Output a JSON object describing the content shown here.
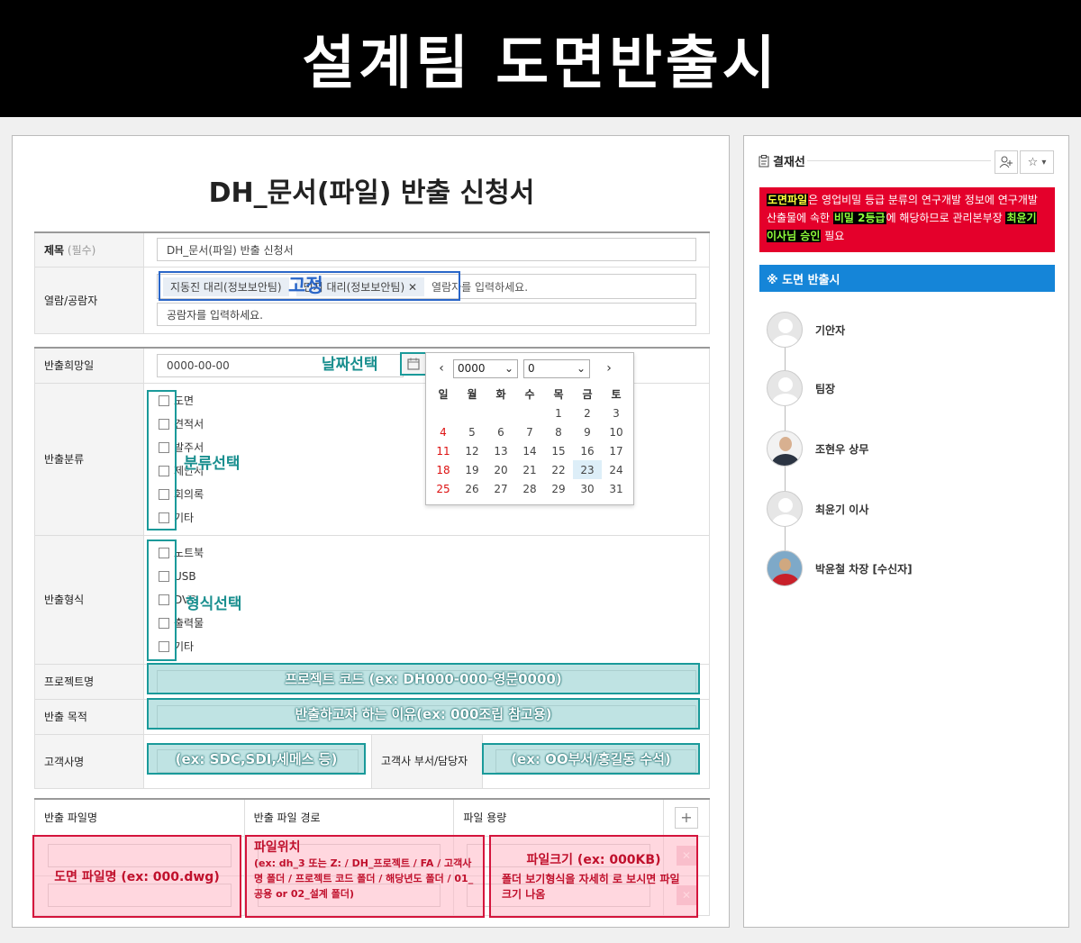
{
  "banner": {
    "title": "설계팀 도면반출시"
  },
  "form": {
    "title": "DH_문서(파일) 반출 신청서",
    "rows": {
      "subject": {
        "label": "제목",
        "required": "(필수)",
        "value": "DH_문서(파일) 반출 신청서"
      },
      "viewers": {
        "label": "열람/공람자",
        "tags": [
          "지동진 대리(정보보안팀)",
          "민지 대리(정보보안팀)"
        ],
        "remove_icon": "✕",
        "viewer_placeholder": "열람자를 입력하세요.",
        "ccviewer_placeholder": "공람자를 입력하세요."
      },
      "date": {
        "label": "반출희망일",
        "value": "0000-00-00"
      },
      "category": {
        "label": "반출분류",
        "options": [
          "도면",
          "견적서",
          "발주서",
          "제안서",
          "회의록",
          "기타"
        ]
      },
      "format": {
        "label": "반출형식",
        "options": [
          "노트북",
          "USB",
          "DVD",
          "출력물",
          "기타"
        ]
      },
      "project": {
        "label": "프로젝트명"
      },
      "purpose": {
        "label": "반출 목적"
      },
      "customer": {
        "label": "고객사명",
        "dept_label": "고객사 부서/담당자"
      }
    },
    "files": {
      "headers": [
        "반출 파일명",
        "반출 파일 경로",
        "파일 용량"
      ],
      "add_icon": "+",
      "remove_icon": "✕"
    }
  },
  "calendar": {
    "year": "0000",
    "month": "0",
    "prev_icon": "‹",
    "next_icon": "›",
    "weekdays": [
      "일",
      "월",
      "화",
      "수",
      "목",
      "금",
      "토"
    ],
    "days": [
      "",
      "",
      "",
      "",
      "1",
      "2",
      "3",
      "4",
      "5",
      "6",
      "7",
      "8",
      "9",
      "10",
      "11",
      "12",
      "13",
      "14",
      "15",
      "16",
      "17",
      "18",
      "19",
      "20",
      "21",
      "22",
      "23",
      "24",
      "25",
      "26",
      "27",
      "28",
      "29",
      "30",
      "31"
    ],
    "today": "23"
  },
  "annotations": {
    "fixed": "고정",
    "date_select": "날짜선택",
    "category_select": "분류선택",
    "format_select": "형식선택",
    "project_hint": "프로젝트 코드 (ex: DH000-000-영문0000)",
    "purpose_hint": "반출하고자 하는 이유(ex: 000조립 참고용)",
    "customer_hint": "(ex: SDC,SDI,세메스 등)",
    "dept_hint": "(ex: OO부서/홍길동 수석)",
    "filename_hint": "도면 파일명 (ex: 000.dwg)",
    "path_title": "파일위치",
    "path_detail": "(ex: dh_3 또는 Z: / DH_프로젝트 / FA / 고객사명 폴더 / 프로젝트 코드 폴더 / 해당년도 폴더 / 01_공용 or 02_설계 폴더)",
    "size_title": "파일크기 (ex: 000KB)",
    "size_detail": "폴더 보기형식을 자세히 로 보시면 파일크기 나옴"
  },
  "sidebar": {
    "title": "결재선",
    "add_user_icon": "+",
    "star_icon": "☆",
    "caret": "▾",
    "notice": {
      "p1": "도면파일",
      "p2": "은 영업비밀 등급 분류의 연구개발 정보에 연구개발 산출물에 속한 ",
      "p3": "비밀 2등급",
      "p4": "에 해당하므로 관리본부장 ",
      "p5": "최윤기 이사님 승인",
      "p6": " 필요"
    },
    "route_name": "※ 도면 반출시",
    "approvers": [
      "기안자",
      "팀장",
      "조현우 상무",
      "최윤기 이사",
      "박윤철 차장 [수신자]"
    ]
  },
  "colors": {
    "teal": "#1a9a9a",
    "blue": "#2a66c8",
    "red": "#e4002b",
    "pink": "#d4143c",
    "route_blue": "#1585d8"
  }
}
